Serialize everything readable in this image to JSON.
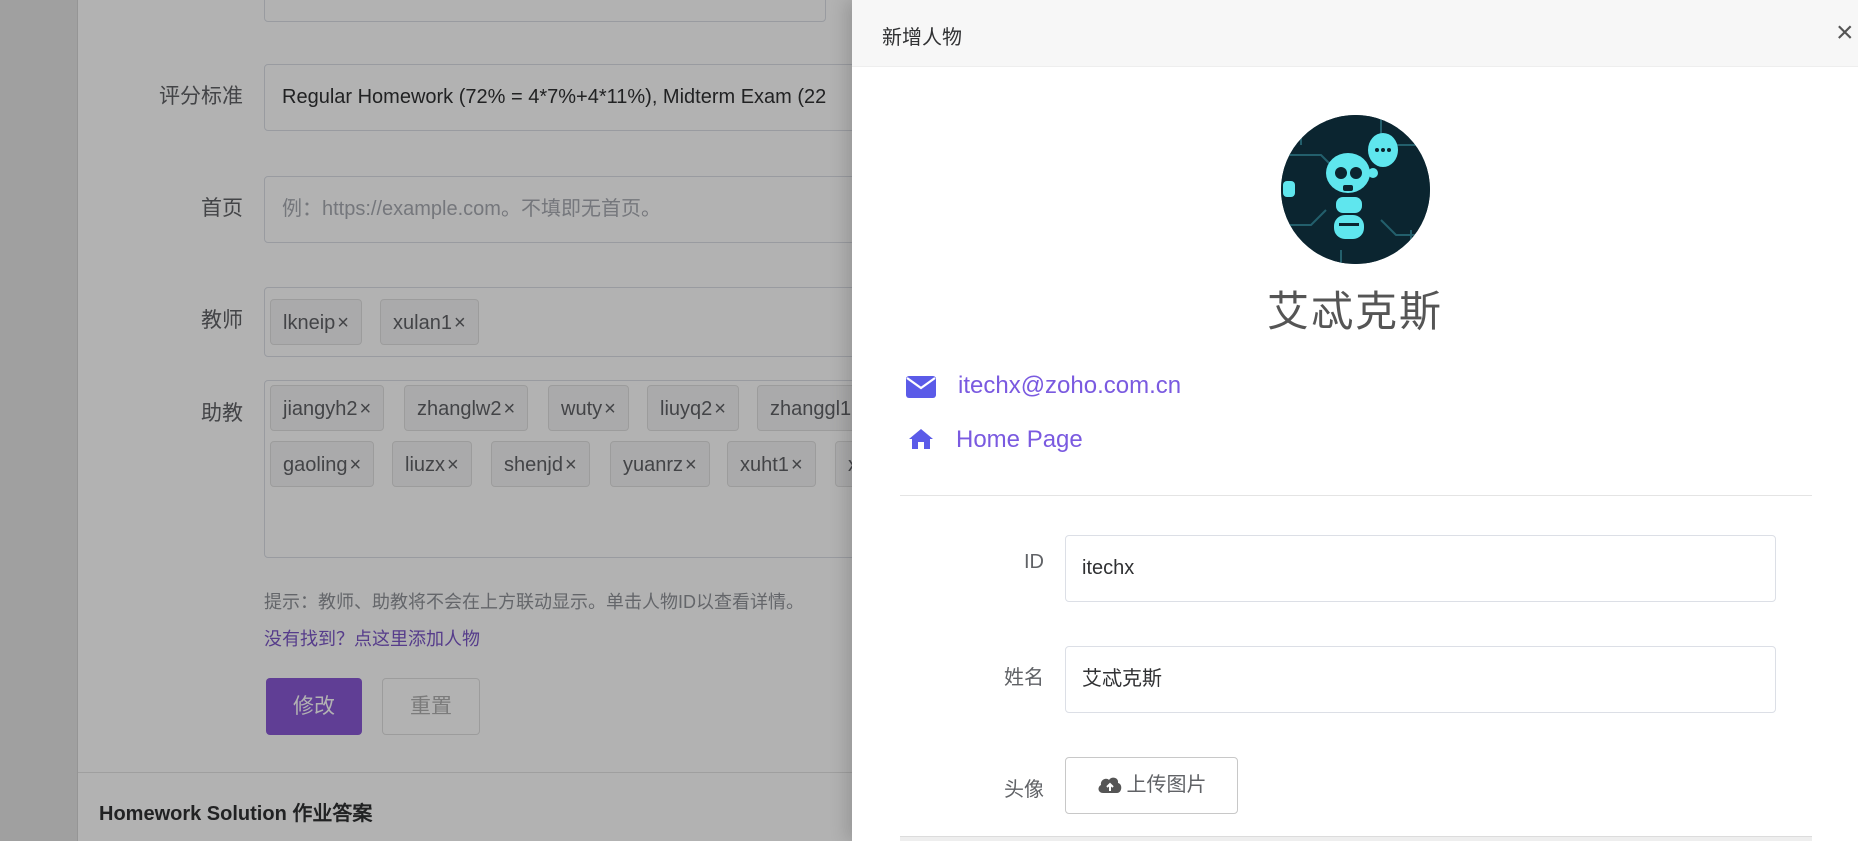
{
  "background_form": {
    "fields": {
      "grading": {
        "label": "评分标准",
        "value": "Regular Homework (72% = 4*7%+4*11%), Midterm Exam (22"
      },
      "homepage": {
        "label": "首页",
        "placeholder": "例：https://example.com。不填即无首页。"
      },
      "teachers": {
        "label": "教师",
        "tags": [
          "lkneip",
          "xulan1"
        ]
      },
      "assistants": {
        "label": "助教",
        "tags_row1": [
          "jiangyh2",
          "zhanglw2",
          "wuty",
          "liuyq2",
          "zhanggl1"
        ],
        "tags_row2": [
          "gaoling",
          "liuzx",
          "shenjd",
          "yuanrz",
          "xuht1",
          "x"
        ]
      }
    },
    "tag_remove_glyph": "×",
    "hint": "提示：教师、助教将不会在上方联动显示。单击人物ID以查看详情。",
    "add_person_link": "没有找到？点这里添加人物",
    "submit_label": "修改",
    "reset_label": "重置",
    "next_section_title": "Homework Solution 作业答案"
  },
  "drawer": {
    "title": "新增人物",
    "close_glyph": "×",
    "profile": {
      "name": "艾忒克斯",
      "email": "itechx@zoho.com.cn",
      "homepage_label": "Home Page"
    },
    "form": {
      "id_label": "ID",
      "id_value": "itechx",
      "name_label": "姓名",
      "name_value": "艾忒克斯",
      "avatar_label": "头像",
      "upload_label": "上传图片"
    }
  },
  "colors": {
    "primary": "#8a5ad6",
    "link": "#7a5ae0",
    "icon": "#5b5be8"
  },
  "icons": {
    "mail": "envelope-icon",
    "home": "home-icon",
    "upload": "cloud-upload-icon",
    "close": "close-icon"
  }
}
